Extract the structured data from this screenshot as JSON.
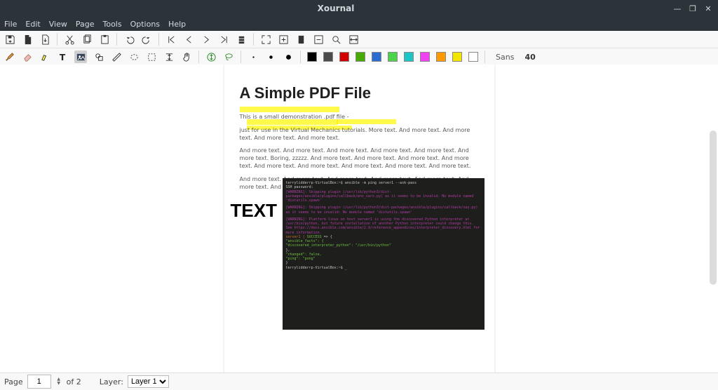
{
  "window": {
    "title": "Xournal",
    "buttons": {
      "min": "—",
      "max": "❐",
      "close": "✕"
    }
  },
  "menu": {
    "items": [
      "File",
      "Edit",
      "View",
      "Page",
      "Tools",
      "Options",
      "Help"
    ]
  },
  "toolbar1": {
    "save": "save",
    "new": "new",
    "open": "open",
    "cut": "cut",
    "copy": "copy",
    "paste": "paste",
    "undo": "undo",
    "redo": "redo",
    "first": "first",
    "prev": "prev",
    "next": "next",
    "last": "last",
    "append": "append",
    "fullscreen": "fullscreen",
    "zoomin": "zoomin",
    "zoomfit": "zoomfit",
    "zoomout": "zoomout",
    "zoom": "zoom",
    "pagewidth": "pagewidth"
  },
  "toolbar2": {
    "pen": "pen",
    "eraser": "eraser",
    "highlighter": "highlighter",
    "text": "text",
    "image": "image",
    "shapes": "shapes",
    "ruler": "ruler",
    "select-region": "select-region",
    "select-rect": "select-rect",
    "vspace": "vspace",
    "hand": "hand",
    "default": "default",
    "lasso": "lasso",
    "thin": "thin",
    "med": "med",
    "thick": "thick",
    "font_name": "Sans",
    "font_size": "40"
  },
  "palette": [
    "#000000",
    "#4b4b4b",
    "#d40000",
    "#48aa00",
    "#2a6cd0",
    "#4cd24c",
    "#1cc6c6",
    "#f042f0",
    "#ff9a00",
    "#f4e500",
    "#ffffff"
  ],
  "document": {
    "title": "A Simple PDF File",
    "p1": "This is a small demonstration .pdf file -",
    "p2": "just for use in the Virtual Mechanics tutorials. More text. And more text. And more text. And more text. And more text.",
    "p3": "And more text. And more text. And more text. And more text. And more text. And more text. Boring, zzzzz. And more text. And more text. And more text. And more text. And more text. And more text. And more text. And more text. And more text.",
    "p4": "And more text. And more text. And more text. And more text. And more text. And more text. And more text. Even more. Continued on page 2 ...",
    "bigtext": "TEXT",
    "terminal": {
      "l0": "terrylidderrp-VirtualBox:~$ ansible -m ping server1 --ask-pass",
      "l1": "SSH password:",
      "l2": "[WARNING]: Skipping plugin (/usr/lib/python3/dist-packages/ansible/plugins/callback/env_vars.py) as it seems to be invalid: No module named 'distutils.spawn'",
      "l3": "[WARNING]: Skipping plugin (/usr/lib/python3/dist-packages/ansible/plugins/callback/say.py) as it seems to be invalid: No module named 'distutils.spawn'",
      "l4": "[WARNING]: Platform linux on host server1 is using the discovered Python interpreter at /usr/bin/python, but future installation of another Python interpreter could change this. See https://docs.ansible.com/ansible/2.9/reference_appendices/interpreter_discovery.html for more information.",
      "l5a": "server1 | ",
      "l5b": "SUCCESS",
      "l5c": " => {",
      "l6": "    \"ansible_facts\": {",
      "l7": "        \"discovered_interpreter_python\": \"/usr/bin/python\"",
      "l8": "    },",
      "l9": "    \"changed\": false,",
      "l10": "    \"ping\": \"pong\"",
      "l11": "}",
      "l12": "terrylidderrp-VirtualBox:~$ _"
    }
  },
  "status": {
    "page_label": "Page",
    "page_current": "1",
    "page_of": "of 2",
    "layer_label": "Layer:",
    "layer_value": "Layer 1"
  }
}
